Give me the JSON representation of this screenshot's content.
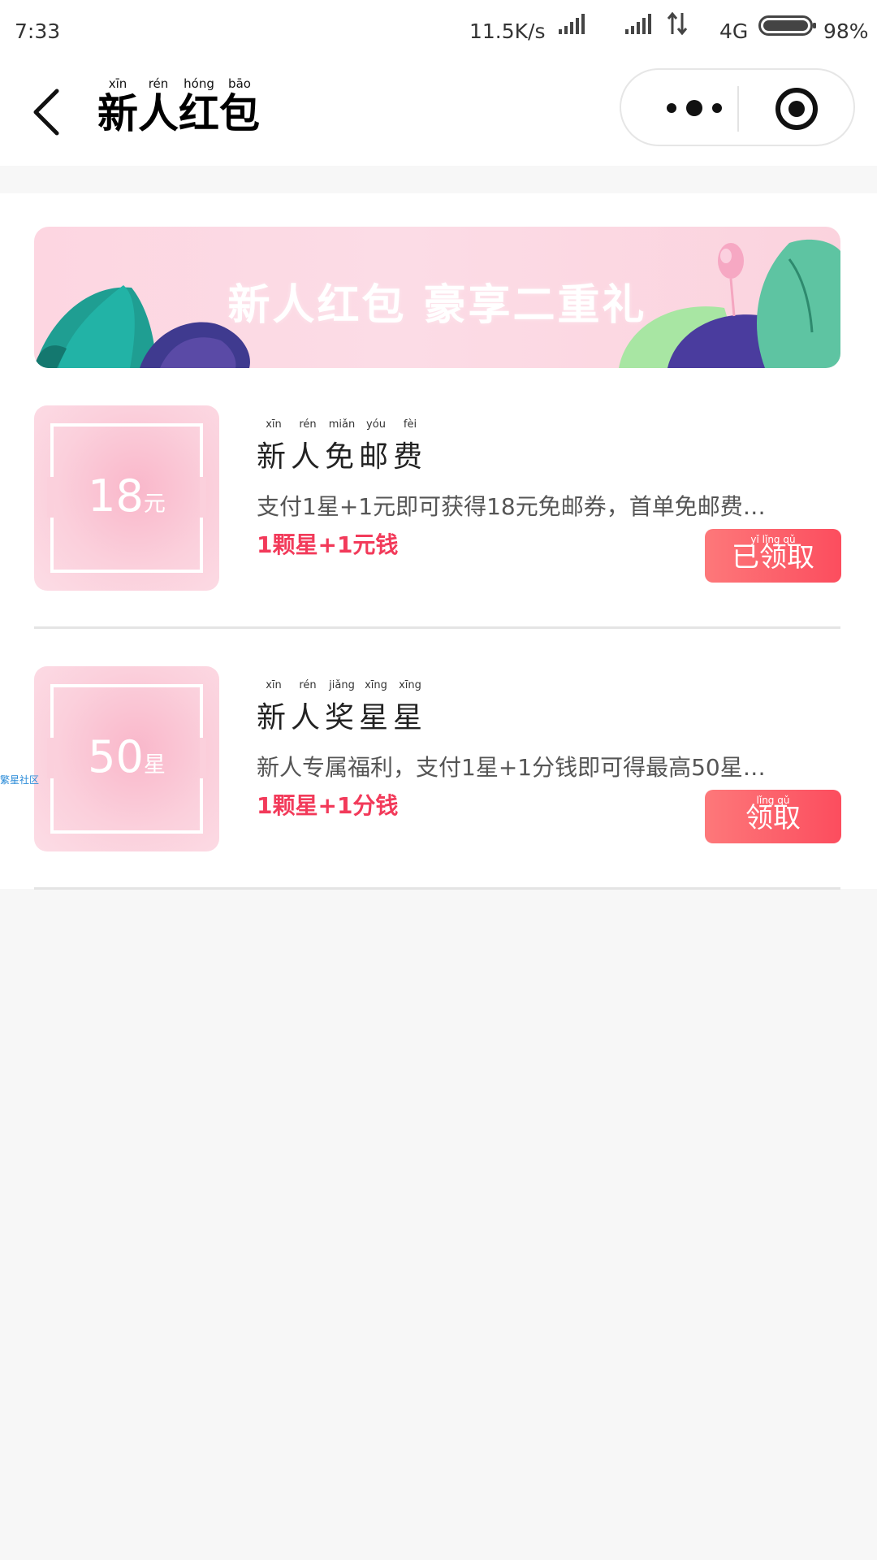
{
  "status_bar": {
    "time": "7:33",
    "speed": "11.5K/s",
    "network": "4G",
    "battery": "98%"
  },
  "nav": {
    "title_chars": [
      {
        "pinyin": "xīn",
        "char": "新"
      },
      {
        "pinyin": "rén",
        "char": "人"
      },
      {
        "pinyin": "hóng",
        "char": "红"
      },
      {
        "pinyin": "bāo",
        "char": "包"
      }
    ]
  },
  "banner": {
    "text": "新人红包 豪享二重礼"
  },
  "coupons": [
    {
      "value": "18",
      "unit": "元",
      "title": "新人免邮费",
      "title_pinyin": [
        "xīn",
        "rén",
        "miǎn",
        "yóu",
        "fèi"
      ],
      "description": "支付1星+1元即可获得18元免邮券，首单免邮费…",
      "price": "1颗星+1元钱",
      "button_label": "已领取",
      "button_pinyin": "yǐ lǐng qǔ"
    },
    {
      "value": "50",
      "unit": "星",
      "title": "新人奖星星",
      "title_pinyin": [
        "xīn",
        "rén",
        "jiǎng",
        "xīng",
        "xīng"
      ],
      "description": "新人专属福利，支付1星+1分钱即可得最高50星…",
      "price": "1颗星+1分钱",
      "button_label": "领取",
      "button_pinyin": "lǐng qǔ"
    }
  ],
  "side_label": "繁星社区",
  "colors": {
    "accent": "#f23a5a",
    "button": "#fc4d5e",
    "banner_bg": "#fcdae4",
    "coupon_bg": "#fbd0dc"
  }
}
